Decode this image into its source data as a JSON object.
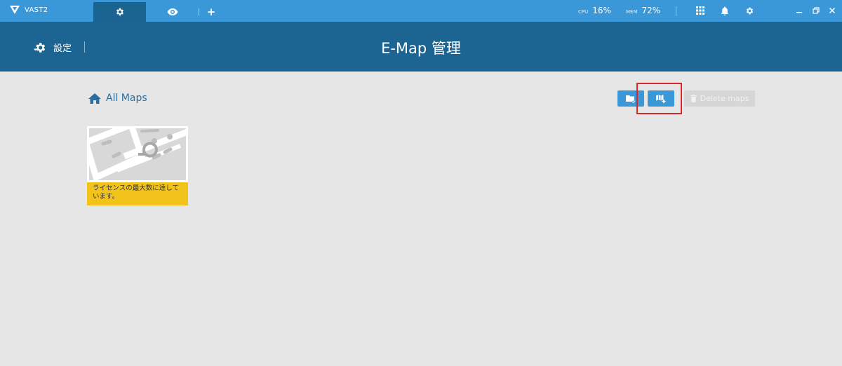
{
  "app": {
    "name": "VAST2"
  },
  "tabs": [
    {
      "icon": "gear-icon",
      "active": true
    },
    {
      "icon": "eye-icon",
      "active": false
    },
    {
      "icon": "plus-icon",
      "label": "+"
    }
  ],
  "stats": {
    "cpu_label": "CPU",
    "cpu_value": "16%",
    "mem_label": "MEM",
    "mem_value": "72%"
  },
  "topbar_icons": [
    "grid-icon",
    "bell-icon",
    "gear-icon"
  ],
  "window_controls": [
    "minimize-icon",
    "restore-icon",
    "close-icon"
  ],
  "header": {
    "settings_label": "設定",
    "title": "E-Map 管理"
  },
  "breadcrumb": {
    "label": "All Maps"
  },
  "toolbar": {
    "add_folder_icon": "folder-add-icon",
    "add_map_icon": "map-add-icon",
    "delete_label": "Delete maps"
  },
  "maps": [
    {
      "thumbnail": "google-map-placeholder",
      "warning": "ライセンスの最大数に達しています。"
    }
  ],
  "colors": {
    "topbar": "#3a97d8",
    "header": "#1c6491",
    "background": "#e6e6e6",
    "button": "#3a97d8",
    "warning": "#f2c31a",
    "highlight": "#d42a2a"
  }
}
